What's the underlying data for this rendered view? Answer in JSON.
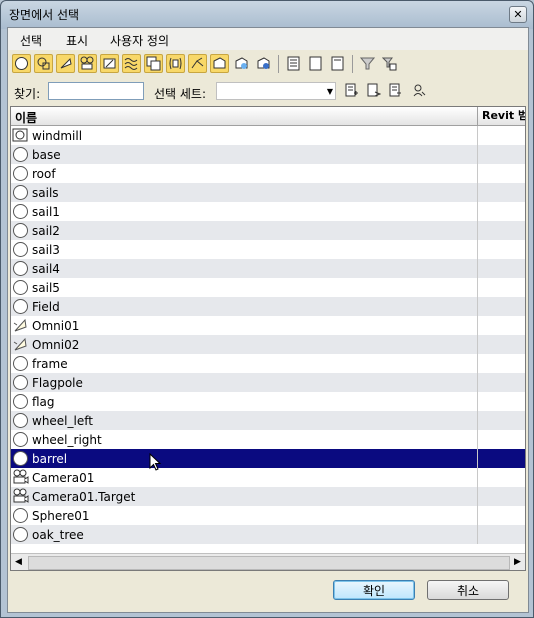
{
  "window": {
    "title": "장면에서 선택",
    "close_glyph": "✕"
  },
  "menu": {
    "items": [
      "선택",
      "표시",
      "사용자 정의"
    ]
  },
  "toolbar": {
    "buttons": [
      "geometry-icon",
      "shapes-icon",
      "lights-icon",
      "cameras-icon",
      "helpers-icon",
      "spacewarps-icon",
      "groups-icon",
      "xrefs-icon",
      "bones-icon",
      "containers-icon",
      "frozen-icon",
      "hidden-icon",
      "display-all-icon",
      "display-none-icon",
      "invert-display-icon",
      "filter-icon",
      "filter-options-icon"
    ]
  },
  "find": {
    "label": "찾기:",
    "value": ""
  },
  "selection_set": {
    "label": "선택 세트:",
    "value": ""
  },
  "list": {
    "header_name": "이름",
    "header_revit": "Revit 범",
    "selected_index": 17,
    "rows": [
      {
        "name": "windmill",
        "icon": "group-icon"
      },
      {
        "name": "base",
        "icon": "geometry-icon"
      },
      {
        "name": "roof",
        "icon": "geometry-icon"
      },
      {
        "name": "sails",
        "icon": "geometry-icon"
      },
      {
        "name": "sail1",
        "icon": "geometry-icon"
      },
      {
        "name": "sail2",
        "icon": "geometry-icon"
      },
      {
        "name": "sail3",
        "icon": "geometry-icon"
      },
      {
        "name": "sail4",
        "icon": "geometry-icon"
      },
      {
        "name": "sail5",
        "icon": "geometry-icon"
      },
      {
        "name": "Field",
        "icon": "geometry-icon"
      },
      {
        "name": "Omni01",
        "icon": "light-icon"
      },
      {
        "name": "Omni02",
        "icon": "light-icon"
      },
      {
        "name": "frame",
        "icon": "geometry-icon"
      },
      {
        "name": "Flagpole",
        "icon": "geometry-icon"
      },
      {
        "name": "flag",
        "icon": "geometry-icon"
      },
      {
        "name": "wheel_left",
        "icon": "geometry-icon"
      },
      {
        "name": "wheel_right",
        "icon": "geometry-icon"
      },
      {
        "name": "barrel",
        "icon": "geometry-icon"
      },
      {
        "name": "Camera01",
        "icon": "camera-icon"
      },
      {
        "name": "Camera01.Target",
        "icon": "camera-icon"
      },
      {
        "name": "Sphere01",
        "icon": "geometry-icon"
      },
      {
        "name": "oak_tree",
        "icon": "geometry-icon"
      }
    ]
  },
  "buttons": {
    "ok": "확인",
    "cancel": "취소"
  },
  "colors": {
    "selection": "#0a0a80",
    "toolbar_active": "#f8d868"
  }
}
